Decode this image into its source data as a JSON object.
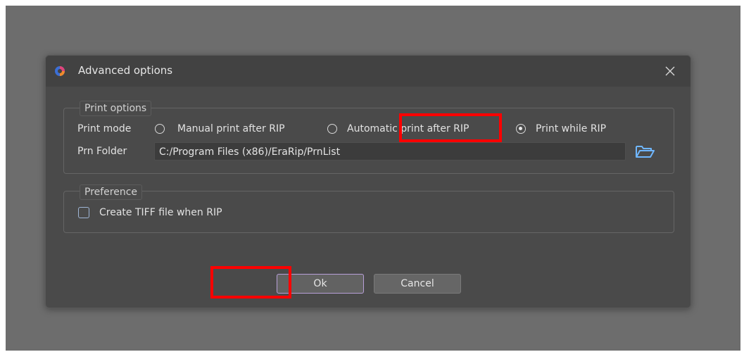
{
  "dialog": {
    "title": "Advanced options",
    "icons": {
      "app": "app-logo-icon",
      "close": "close-icon"
    }
  },
  "print_options": {
    "legend": "Print options",
    "print_mode_label": "Print mode",
    "modes": [
      {
        "label": "Manual print after RIP",
        "selected": false
      },
      {
        "label": "Automatic print after RIP",
        "selected": false
      },
      {
        "label": "Print while RIP",
        "selected": true
      }
    ],
    "prn_folder_label": "Prn Folder",
    "prn_folder_value": "C:/Program Files (x86)/EraRip/PrnList",
    "folder_icon": "folder-open-icon"
  },
  "preference": {
    "legend": "Preference",
    "create_tiff_label": "Create TIFF file when RIP",
    "create_tiff_checked": false
  },
  "buttons": {
    "ok": "Ok",
    "cancel": "Cancel"
  },
  "colors": {
    "dialog_bg": "#4a4a4a",
    "titlebar_bg": "#424242",
    "highlight": "#ff0000",
    "ok_border": "#b79fd8"
  }
}
